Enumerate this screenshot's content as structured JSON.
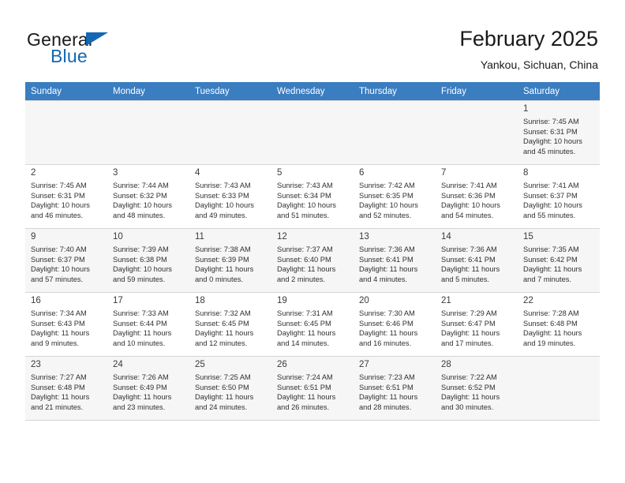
{
  "brand": {
    "name_part1": "General",
    "name_part2": "Blue"
  },
  "header": {
    "title": "February 2025",
    "subtitle": "Yankou, Sichuan, China"
  },
  "colors": {
    "header_row_bg": "#3a7dc0",
    "brand_blue": "#1268b3",
    "alt_row_bg": "#f6f6f6",
    "grid_line": "#d5d5d5"
  },
  "weekdays": [
    "Sunday",
    "Monday",
    "Tuesday",
    "Wednesday",
    "Thursday",
    "Friday",
    "Saturday"
  ],
  "labels": {
    "sunrise": "Sunrise:",
    "sunset": "Sunset:",
    "daylight": "Daylight:"
  },
  "weeks": [
    [
      {
        "day": "",
        "empty": true
      },
      {
        "day": "",
        "empty": true
      },
      {
        "day": "",
        "empty": true
      },
      {
        "day": "",
        "empty": true
      },
      {
        "day": "",
        "empty": true
      },
      {
        "day": "",
        "empty": true
      },
      {
        "day": "1",
        "sunrise": "Sunrise: 7:45 AM",
        "sunset": "Sunset: 6:31 PM",
        "daylight_l1": "Daylight: 10 hours",
        "daylight_l2": "and 45 minutes."
      }
    ],
    [
      {
        "day": "2",
        "sunrise": "Sunrise: 7:45 AM",
        "sunset": "Sunset: 6:31 PM",
        "daylight_l1": "Daylight: 10 hours",
        "daylight_l2": "and 46 minutes."
      },
      {
        "day": "3",
        "sunrise": "Sunrise: 7:44 AM",
        "sunset": "Sunset: 6:32 PM",
        "daylight_l1": "Daylight: 10 hours",
        "daylight_l2": "and 48 minutes."
      },
      {
        "day": "4",
        "sunrise": "Sunrise: 7:43 AM",
        "sunset": "Sunset: 6:33 PM",
        "daylight_l1": "Daylight: 10 hours",
        "daylight_l2": "and 49 minutes."
      },
      {
        "day": "5",
        "sunrise": "Sunrise: 7:43 AM",
        "sunset": "Sunset: 6:34 PM",
        "daylight_l1": "Daylight: 10 hours",
        "daylight_l2": "and 51 minutes."
      },
      {
        "day": "6",
        "sunrise": "Sunrise: 7:42 AM",
        "sunset": "Sunset: 6:35 PM",
        "daylight_l1": "Daylight: 10 hours",
        "daylight_l2": "and 52 minutes."
      },
      {
        "day": "7",
        "sunrise": "Sunrise: 7:41 AM",
        "sunset": "Sunset: 6:36 PM",
        "daylight_l1": "Daylight: 10 hours",
        "daylight_l2": "and 54 minutes."
      },
      {
        "day": "8",
        "sunrise": "Sunrise: 7:41 AM",
        "sunset": "Sunset: 6:37 PM",
        "daylight_l1": "Daylight: 10 hours",
        "daylight_l2": "and 55 minutes."
      }
    ],
    [
      {
        "day": "9",
        "sunrise": "Sunrise: 7:40 AM",
        "sunset": "Sunset: 6:37 PM",
        "daylight_l1": "Daylight: 10 hours",
        "daylight_l2": "and 57 minutes."
      },
      {
        "day": "10",
        "sunrise": "Sunrise: 7:39 AM",
        "sunset": "Sunset: 6:38 PM",
        "daylight_l1": "Daylight: 10 hours",
        "daylight_l2": "and 59 minutes."
      },
      {
        "day": "11",
        "sunrise": "Sunrise: 7:38 AM",
        "sunset": "Sunset: 6:39 PM",
        "daylight_l1": "Daylight: 11 hours",
        "daylight_l2": "and 0 minutes."
      },
      {
        "day": "12",
        "sunrise": "Sunrise: 7:37 AM",
        "sunset": "Sunset: 6:40 PM",
        "daylight_l1": "Daylight: 11 hours",
        "daylight_l2": "and 2 minutes."
      },
      {
        "day": "13",
        "sunrise": "Sunrise: 7:36 AM",
        "sunset": "Sunset: 6:41 PM",
        "daylight_l1": "Daylight: 11 hours",
        "daylight_l2": "and 4 minutes."
      },
      {
        "day": "14",
        "sunrise": "Sunrise: 7:36 AM",
        "sunset": "Sunset: 6:41 PM",
        "daylight_l1": "Daylight: 11 hours",
        "daylight_l2": "and 5 minutes."
      },
      {
        "day": "15",
        "sunrise": "Sunrise: 7:35 AM",
        "sunset": "Sunset: 6:42 PM",
        "daylight_l1": "Daylight: 11 hours",
        "daylight_l2": "and 7 minutes."
      }
    ],
    [
      {
        "day": "16",
        "sunrise": "Sunrise: 7:34 AM",
        "sunset": "Sunset: 6:43 PM",
        "daylight_l1": "Daylight: 11 hours",
        "daylight_l2": "and 9 minutes."
      },
      {
        "day": "17",
        "sunrise": "Sunrise: 7:33 AM",
        "sunset": "Sunset: 6:44 PM",
        "daylight_l1": "Daylight: 11 hours",
        "daylight_l2": "and 10 minutes."
      },
      {
        "day": "18",
        "sunrise": "Sunrise: 7:32 AM",
        "sunset": "Sunset: 6:45 PM",
        "daylight_l1": "Daylight: 11 hours",
        "daylight_l2": "and 12 minutes."
      },
      {
        "day": "19",
        "sunrise": "Sunrise: 7:31 AM",
        "sunset": "Sunset: 6:45 PM",
        "daylight_l1": "Daylight: 11 hours",
        "daylight_l2": "and 14 minutes."
      },
      {
        "day": "20",
        "sunrise": "Sunrise: 7:30 AM",
        "sunset": "Sunset: 6:46 PM",
        "daylight_l1": "Daylight: 11 hours",
        "daylight_l2": "and 16 minutes."
      },
      {
        "day": "21",
        "sunrise": "Sunrise: 7:29 AM",
        "sunset": "Sunset: 6:47 PM",
        "daylight_l1": "Daylight: 11 hours",
        "daylight_l2": "and 17 minutes."
      },
      {
        "day": "22",
        "sunrise": "Sunrise: 7:28 AM",
        "sunset": "Sunset: 6:48 PM",
        "daylight_l1": "Daylight: 11 hours",
        "daylight_l2": "and 19 minutes."
      }
    ],
    [
      {
        "day": "23",
        "sunrise": "Sunrise: 7:27 AM",
        "sunset": "Sunset: 6:48 PM",
        "daylight_l1": "Daylight: 11 hours",
        "daylight_l2": "and 21 minutes."
      },
      {
        "day": "24",
        "sunrise": "Sunrise: 7:26 AM",
        "sunset": "Sunset: 6:49 PM",
        "daylight_l1": "Daylight: 11 hours",
        "daylight_l2": "and 23 minutes."
      },
      {
        "day": "25",
        "sunrise": "Sunrise: 7:25 AM",
        "sunset": "Sunset: 6:50 PM",
        "daylight_l1": "Daylight: 11 hours",
        "daylight_l2": "and 24 minutes."
      },
      {
        "day": "26",
        "sunrise": "Sunrise: 7:24 AM",
        "sunset": "Sunset: 6:51 PM",
        "daylight_l1": "Daylight: 11 hours",
        "daylight_l2": "and 26 minutes."
      },
      {
        "day": "27",
        "sunrise": "Sunrise: 7:23 AM",
        "sunset": "Sunset: 6:51 PM",
        "daylight_l1": "Daylight: 11 hours",
        "daylight_l2": "and 28 minutes."
      },
      {
        "day": "28",
        "sunrise": "Sunrise: 7:22 AM",
        "sunset": "Sunset: 6:52 PM",
        "daylight_l1": "Daylight: 11 hours",
        "daylight_l2": "and 30 minutes."
      },
      {
        "day": "",
        "empty": true
      }
    ]
  ]
}
